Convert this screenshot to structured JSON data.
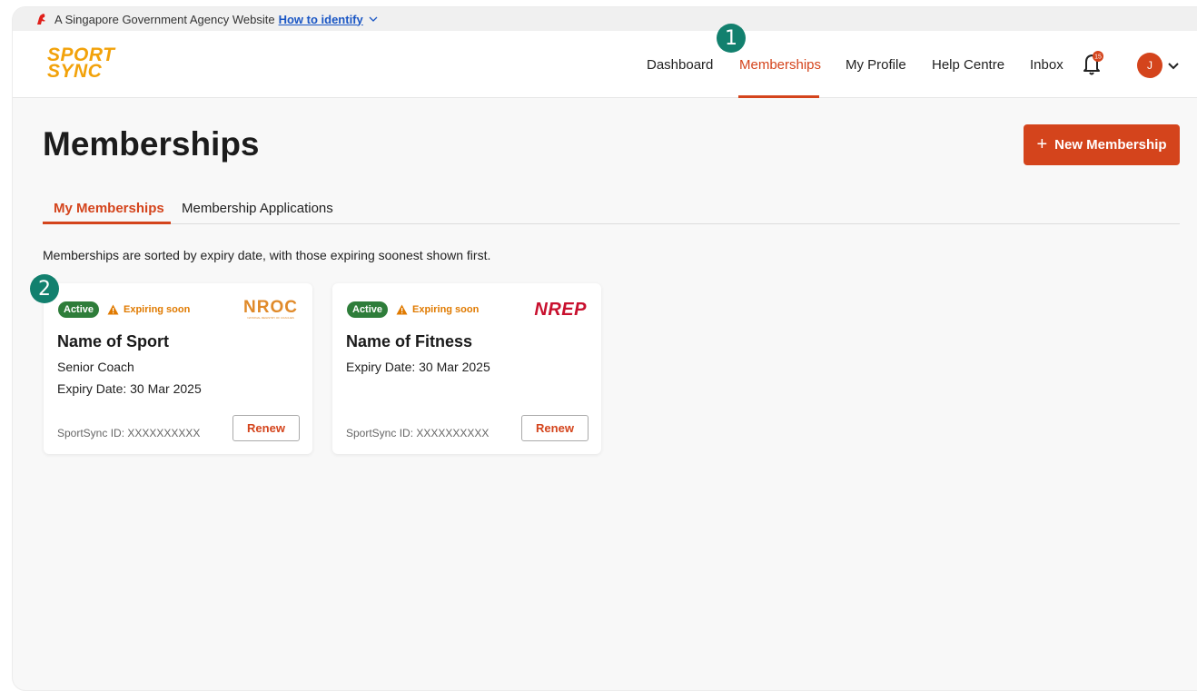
{
  "gov_banner": {
    "text": "A Singapore Government Agency Website",
    "link": "How to identify"
  },
  "brand": {
    "line1": "SPORT",
    "line2": "SYNC"
  },
  "nav": {
    "items": [
      "Dashboard",
      "Memberships",
      "My Profile",
      "Help Centre",
      "Inbox"
    ],
    "active": "Memberships",
    "notification_count": "15",
    "avatar_initial": "J"
  },
  "annotations": [
    "1",
    "2"
  ],
  "page": {
    "title": "Memberships",
    "new_button": "New Membership",
    "tabs": [
      "My Memberships",
      "Membership Applications"
    ],
    "active_tab": "My Memberships",
    "sort_note": "Memberships are sorted by expiry date, with those expiring soonest shown first."
  },
  "cards": [
    {
      "status": "Active",
      "warning": "Expiring soon",
      "logo_text": "NROC",
      "logo_subtext": "NATIONAL REGISTRY OF COACHES",
      "title": "Name of Sport",
      "role": "Senior Coach",
      "expiry": "Expiry Date: 30 Mar 2025",
      "id": "SportSync ID: XXXXXXXXXX",
      "action": "Renew"
    },
    {
      "status": "Active",
      "warning": "Expiring soon",
      "logo_text": "NREP",
      "title": "Name of Fitness",
      "expiry": "Expiry Date: 30 Mar 2025",
      "id": "SportSync ID: XXXXXXXXXX",
      "action": "Renew"
    }
  ],
  "colors": {
    "accent": "#d4441c",
    "brand": "#f2a20a",
    "success": "#2e7d3a",
    "warning": "#e07a00",
    "annotation": "#12806e",
    "nrep": "#c8102e"
  }
}
